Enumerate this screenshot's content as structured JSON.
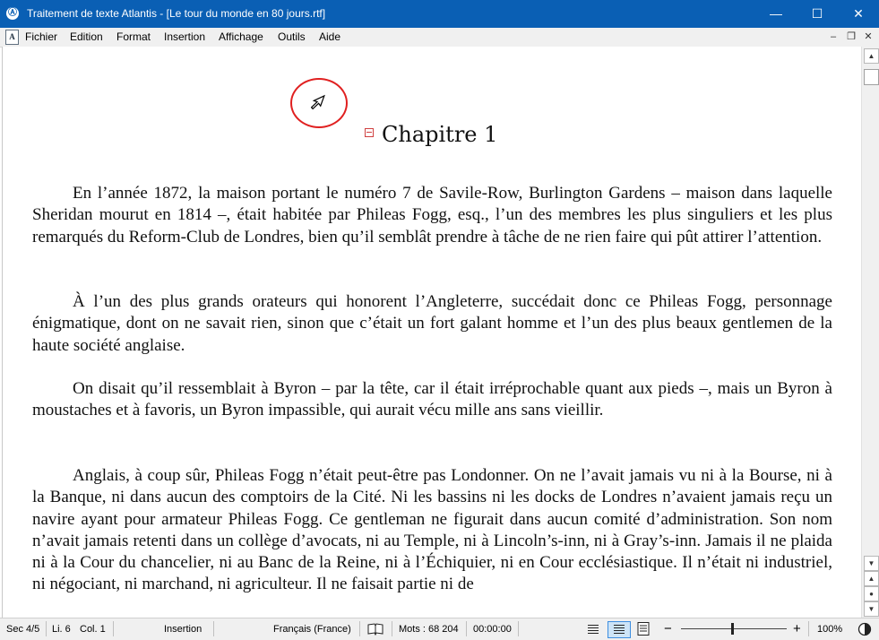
{
  "window": {
    "app_icon": "Ⓐ",
    "title": "Traitement de texte Atlantis - [Le tour du monde en 80 jours.rtf]",
    "minimize": "—",
    "maximize": "☐",
    "close": "✕"
  },
  "menubar": {
    "items": [
      "Fichier",
      "Edition",
      "Format",
      "Insertion",
      "Affichage",
      "Outils",
      "Aide"
    ],
    "mdi_minimize": "–",
    "mdi_restore": "❐",
    "mdi_close": "✕"
  },
  "document": {
    "chapter_title": "Chapitre 1",
    "paragraphs": [
      "En l’année 1872, la maison portant le numéro 7 de Savile-Row, Burlington Gardens – maison dans laquelle Sheridan mourut en 1814 –, était habitée par Phileas Fogg, esq., l’un des membres les plus singuliers et les plus remarqués du Reform-Club de Londres, bien qu’il semblât prendre à tâche de ne rien faire qui pût attirer l’attention.",
      "À l’un des plus grands orateurs qui honorent l’Angleterre, succédait donc ce Phileas Fogg, personnage énigmatique, dont on ne savait rien, sinon que c’était un fort galant homme et l’un des plus beaux gentlemen de la haute société anglaise.",
      "On disait qu’il ressemblait à Byron – par la tête, car il était irréprochable quant aux pieds –, mais un Byron à moustaches et à favoris, un Byron impassible, qui aurait vécu mille ans sans vieillir.",
      "Anglais, à coup sûr, Phileas Fogg n’était peut-être pas Londonner. On ne l’avait jamais vu ni à la Bourse, ni à la Banque, ni dans aucun des comptoirs de la Cité. Ni les bassins ni les docks de Londres n’avaient jamais reçu un navire ayant pour armateur Phileas Fogg. Ce gentleman ne figurait dans aucun comité d’administration. Son nom n’avait jamais retenti dans un collège d’avocats, ni au Temple, ni à Lincoln’s-inn, ni à Gray’s-inn. Jamais il ne plaida ni à la Cour du chancelier, ni au Banc de la Reine, ni à l’Échiquier, ni en Cour ecclésiastique. Il n’était ni industriel, ni négociant, ni marchand, ni agriculteur. Il ne faisait partie ni de"
    ]
  },
  "statusbar": {
    "section": "Sec 4/5",
    "line": "Li. 6",
    "column": "Col. 1",
    "mode": "Insertion",
    "language": "Français (France)",
    "words": "Mots : 68 204",
    "time": "00:00:00",
    "zoom_minus": "−",
    "zoom_plus": "+",
    "zoom": "100%"
  },
  "scrollbar": {
    "up": "▲",
    "down": "▼",
    "prev_page": "▲",
    "browse": "●",
    "next_page": "▼"
  }
}
